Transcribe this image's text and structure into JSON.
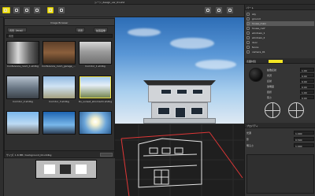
{
  "window": {
    "title": "シーン_design_ver_01.shd"
  },
  "browser": {
    "title": "Image Browser",
    "tabs": [
      {
        "label": "背景（HDR）"
      },
      {
        "label": "背景"
      },
      {
        "label": "拡張画像"
      }
    ],
    "search_label": "背景",
    "items": [
      {
        "caption": "Conference_room_1.shdbg",
        "selected": false
      },
      {
        "caption": "Conference_room_garage_1.shdbg",
        "selected": false
      },
      {
        "caption": "Corridor_1.shdbg",
        "selected": false
      },
      {
        "caption": "Corridor_2.shdbg",
        "selected": false
      },
      {
        "caption": "Corridor_3.shdbg",
        "selected": false
      },
      {
        "caption": "Ru_sunset_shiomachi.shdbg",
        "selected": true
      },
      {
        "caption": "",
        "selected": false
      },
      {
        "caption": "",
        "selected": false
      },
      {
        "caption": "",
        "selected": false
      }
    ],
    "footer_path": "サイズ: 1.6 MB / background_02.shdbg"
  },
  "right_panel": {
    "sections": [
      {
        "label": "パート"
      },
      {
        "label": "表面材質"
      },
      {
        "label": "プロパティ"
      }
    ],
    "tree_items": [
      {
        "label": "sky"
      },
      {
        "label": "ground"
      },
      {
        "label": "house_main"
      },
      {
        "label": "house_roof"
      },
      {
        "label": "windows_1"
      },
      {
        "label": "windows_2"
      },
      {
        "label": "door"
      },
      {
        "label": "fence"
      },
      {
        "label": "camera_01"
      }
    ],
    "material_fields": [
      {
        "label": "拡散反射",
        "value": "1.00"
      },
      {
        "label": "光沢",
        "value": "0.00"
      },
      {
        "label": "反射",
        "value": "0.00"
      },
      {
        "label": "透明度",
        "value": "0.00"
      },
      {
        "label": "屈折",
        "value": "1.00"
      },
      {
        "label": "荒さ",
        "value": "0.00"
      }
    ],
    "props": [
      {
        "label": "光源",
        "value": "1.000"
      },
      {
        "label": "影",
        "value": "0.500"
      },
      {
        "label": "明るさ",
        "value": "1.000"
      }
    ]
  },
  "colors": {
    "accent": "#f4e623",
    "panel_bg": "#353535",
    "viewport_sky_top": "#2d6db6",
    "viewport_sky_bottom": "#dfe9f3"
  },
  "icons": [
    "select-icon",
    "move-icon",
    "rotate-icon",
    "scale-icon",
    "render-icon",
    "camera-icon",
    "light-icon"
  ]
}
